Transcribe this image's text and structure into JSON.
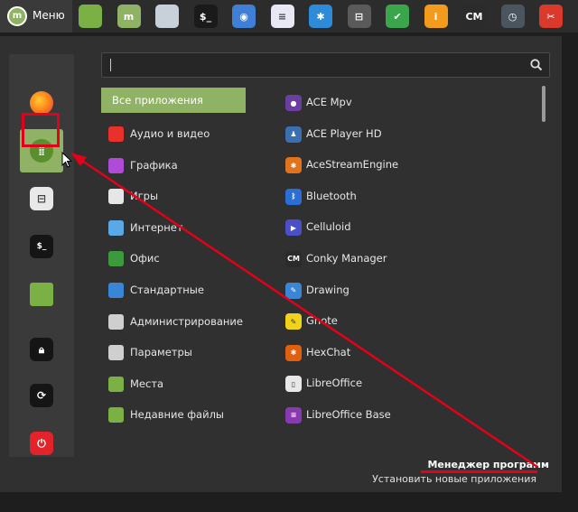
{
  "taskbar": {
    "menu_label": "Меню",
    "launchers": [
      {
        "name": "files-icon",
        "color": "#7bb045",
        "glyph": ""
      },
      {
        "name": "mintinstall-icon",
        "color": "#8fb264",
        "glyph": "m"
      },
      {
        "name": "xplayer-icon",
        "color": "#c8d0da",
        "glyph": ""
      },
      {
        "name": "terminal-icon",
        "color": "#1a1a1a",
        "glyph": "$_"
      },
      {
        "name": "camera-icon",
        "color": "#3f7fd6",
        "glyph": "◉"
      },
      {
        "name": "text-editor-icon",
        "color": "#e8e8f5",
        "glyph": "≡"
      },
      {
        "name": "acestream-icon",
        "color": "#2e8bd8",
        "glyph": "✱"
      },
      {
        "name": "settings-icon",
        "color": "#5a5a5a",
        "glyph": "⊟"
      },
      {
        "name": "firewall-icon",
        "color": "#3aa54a",
        "glyph": "✔"
      },
      {
        "name": "info-icon",
        "color": "#f29b1c",
        "glyph": "i"
      },
      {
        "name": "conky-manager-icon",
        "color": "#2b2b2b",
        "glyph": "CM"
      },
      {
        "name": "timeshift-icon",
        "color": "#4a5560",
        "glyph": "◷"
      },
      {
        "name": "stacer-icon",
        "color": "#d93a2b",
        "glyph": "✂"
      }
    ]
  },
  "search": {
    "value": "",
    "placeholder": ""
  },
  "categories": [
    {
      "label": "Все приложения",
      "icon": "none",
      "color": "",
      "selected": true
    },
    {
      "label": "Аудио и видео",
      "icon": "multimedia-icon",
      "color": "#e8312a",
      "selected": false
    },
    {
      "label": "Графика",
      "icon": "graphics-icon",
      "color": "#b04bd8",
      "selected": false
    },
    {
      "label": "Игры",
      "icon": "games-icon",
      "color": "#e6e6e6",
      "selected": false
    },
    {
      "label": "Интернет",
      "icon": "internet-icon",
      "color": "#5aa9e6",
      "selected": false
    },
    {
      "label": "Офис",
      "icon": "office-icon",
      "color": "#3c9a3c",
      "selected": false
    },
    {
      "label": "Стандартные",
      "icon": "accessories-icon",
      "color": "#3a86d6",
      "selected": false
    },
    {
      "label": "Администрирование",
      "icon": "administration-icon",
      "color": "#cfcfcf",
      "selected": false
    },
    {
      "label": "Параметры",
      "icon": "preferences-icon",
      "color": "#cfcfcf",
      "selected": false
    },
    {
      "label": "Места",
      "icon": "folder-icon",
      "color": "#7bb045",
      "selected": false
    },
    {
      "label": "Недавние файлы",
      "icon": "recent-icon",
      "color": "#7bb045",
      "selected": false
    }
  ],
  "apps": [
    {
      "label": "ACE Mpv",
      "icon": "ace-mpv-icon",
      "color": "#6b3fa0",
      "glyph": "●"
    },
    {
      "label": "ACE Player HD",
      "icon": "ace-player-icon",
      "color": "#3a6fb0",
      "glyph": "♟"
    },
    {
      "label": "AceStreamEngine",
      "icon": "acestream-engine-icon",
      "color": "#e0731c",
      "glyph": "✱"
    },
    {
      "label": "Bluetooth",
      "icon": "bluetooth-icon",
      "color": "#2b6fd6",
      "glyph": "ᛒ"
    },
    {
      "label": "Celluloid",
      "icon": "celluloid-icon",
      "color": "#4b4fc8",
      "glyph": "▶"
    },
    {
      "label": "Conky Manager",
      "icon": "conky-icon",
      "color": "#2b2b2b",
      "glyph": "CM"
    },
    {
      "label": "Drawing",
      "icon": "drawing-icon",
      "color": "#3a86d6",
      "glyph": "✎"
    },
    {
      "label": "Gnote",
      "icon": "gnote-icon",
      "color": "#f2d31c",
      "glyph": "✎"
    },
    {
      "label": "HexChat",
      "icon": "hexchat-icon",
      "color": "#e06010",
      "glyph": "✱"
    },
    {
      "label": "LibreOffice",
      "icon": "libreoffice-icon",
      "color": "#e8e8e8",
      "glyph": "▯"
    },
    {
      "label": "LibreOffice Base",
      "icon": "libreoffice-base-icon",
      "color": "#8a3ab0",
      "glyph": "≡"
    }
  ],
  "footer": {
    "title": "Менеджер программ",
    "description": "Установить новые приложения"
  },
  "colors": {
    "accent": "#8fb264",
    "annotation": "#e2001a"
  }
}
